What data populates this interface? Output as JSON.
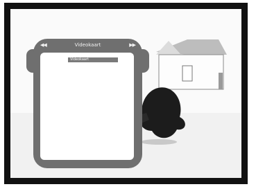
{
  "osd": {
    "title": "Videokaart",
    "prev_icon": "◀◀",
    "next_icon": "▶▶",
    "icons": {
      "prev": "rewind-icon",
      "next": "fast-forward-icon"
    },
    "selected_item": "Videokaart",
    "colors": {
      "panel": "#6f6f6f",
      "list_bg": "#ffffff",
      "highlight": "#7a7a7a",
      "frame": "#111111"
    }
  }
}
